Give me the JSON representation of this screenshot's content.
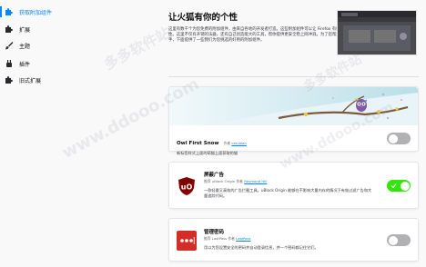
{
  "sidebar": {
    "items": [
      {
        "label": "获取附加组件",
        "icon": "puzzle-icon"
      },
      {
        "label": "扩展",
        "icon": "puzzle-icon"
      },
      {
        "label": "主题",
        "icon": "brush-icon"
      },
      {
        "label": "插件",
        "icon": "plugin-icon"
      },
      {
        "label": "旧式扩展",
        "icon": "puzzle-icon"
      }
    ]
  },
  "main": {
    "title": "让火狐有你的个性",
    "intro": "这里有数千个为您免费的附加组件，由来自各地的开发者打造。这些附加组件可以让 Firefox 有你的个性。这里不仅有开销的法器，还有自己创造能大的工具，帮你提供更安全稳上网冲浪。为了您帮您上手，下面提供了一些我们为您挑选的好用的附加组件。"
  },
  "cards": {
    "owl": {
      "name": "Owl First Snow",
      "by_prefix": "作者",
      "author": "cerulean",
      "desc": "新标签样式上面的萌猫上面获取的猫",
      "enabled": false
    },
    "ublock": {
      "name": "屏蔽广告",
      "by_prefix": "推荐 uBlock Origin 作者",
      "author": "Raymond Hill",
      "desc": "一款轻量又高效的广告拦截工具。uBlock Origin 能够在不影响大量内存的情况下有效过滤广告和大量追踪代码。",
      "enabled": true
    },
    "lastpass": {
      "name": "管理密码",
      "by_prefix": "推荐 LastPass 作者",
      "author": "LastPass",
      "desc": "用以为您设置安全的密码并自动登录信息，并一个密码都记住它们。",
      "enabled": false
    }
  },
  "watermarks": [
    "多多软件站",
    "www.ddooo.com",
    "多多软件站",
    "www.ddooo.com"
  ],
  "colors": {
    "accent": "#0a84ff",
    "toggle_on": "#30e60b",
    "toggle_off": "#b1b1b3",
    "ublock_red": "#800000",
    "lastpass_red": "#d32d27"
  }
}
